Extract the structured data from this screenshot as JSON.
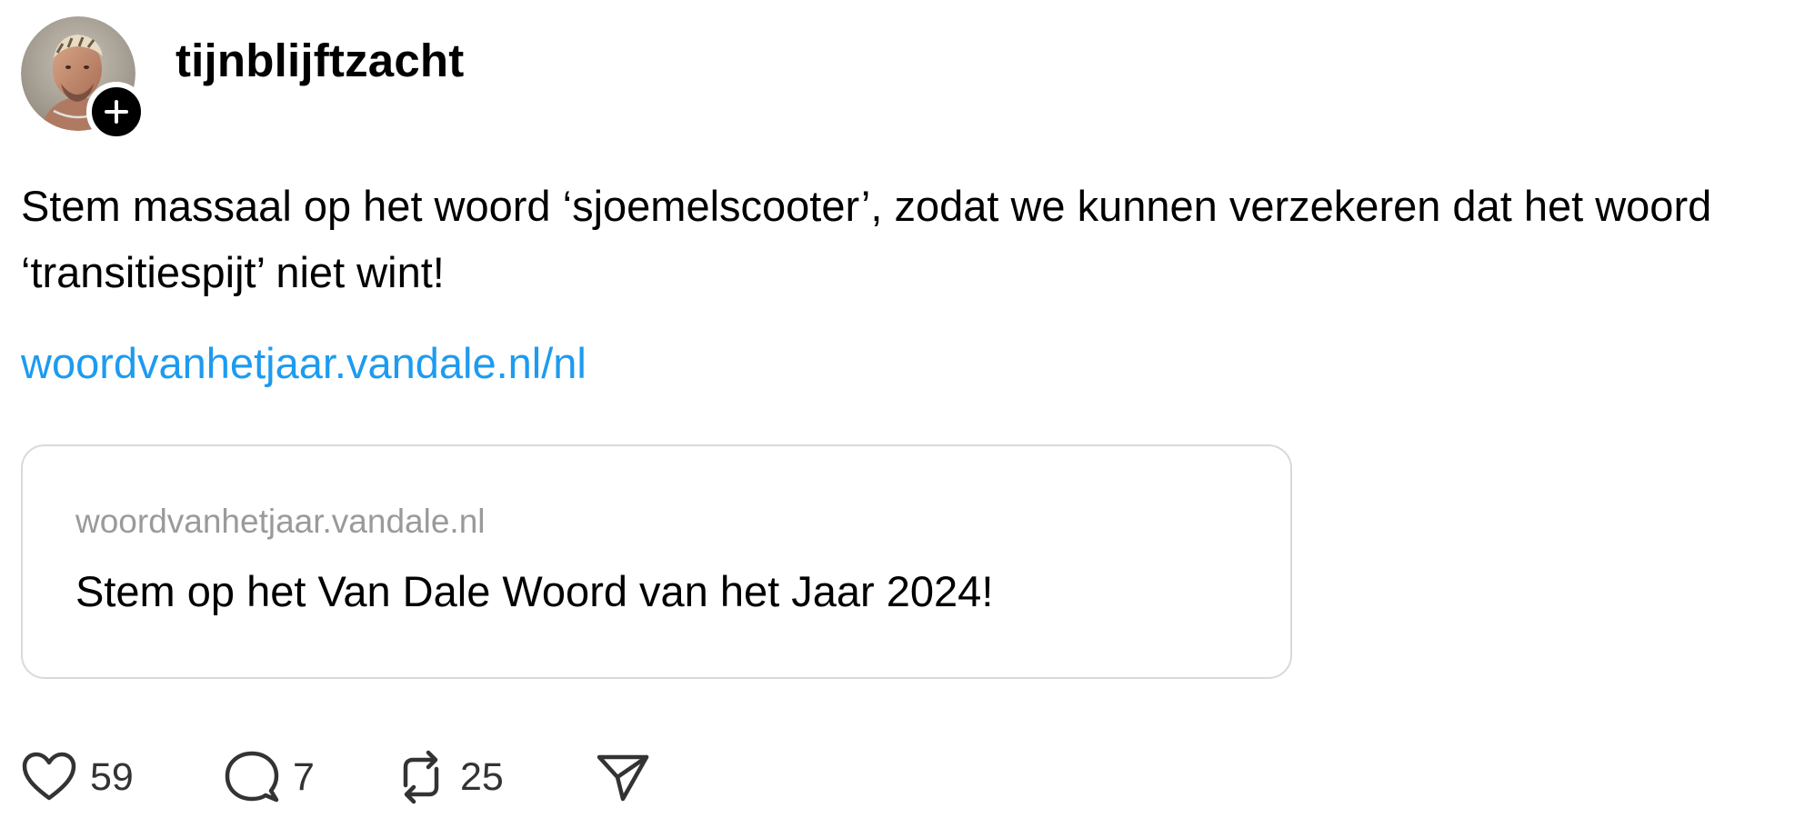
{
  "post": {
    "username": "tijnblijftzacht",
    "avatar_icon": "user-avatar-photo",
    "follow_icon": "plus-icon",
    "text": "Stem massaal op het woord ‘sjoemelscooter’, zodat we kunnen verzekeren dat het woord ‘transitiespijt’ niet wint!",
    "link_text": "woordvanhetjaar.vandale.nl/nl",
    "link_color": "#1d9bf0",
    "card": {
      "domain": "woordvanhetjaar.vandale.nl",
      "title": "Stem op het Van Dale Woord van het Jaar 2024!"
    }
  },
  "actions": {
    "like": {
      "icon": "heart-icon",
      "count": "59"
    },
    "reply": {
      "icon": "speech-bubble-icon",
      "count": "7"
    },
    "repost": {
      "icon": "repost-icon",
      "count": "25"
    },
    "share": {
      "icon": "paper-plane-icon"
    }
  }
}
